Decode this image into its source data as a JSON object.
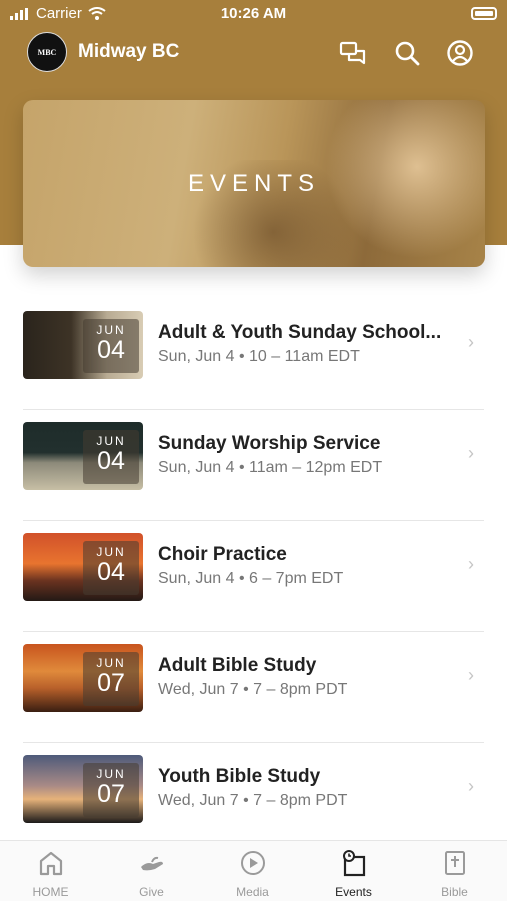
{
  "status_bar": {
    "carrier": "Carrier",
    "time": "10:26 AM"
  },
  "header": {
    "app_name": "Midway BC",
    "logo_text": "MBC"
  },
  "hero": {
    "title": "EVENTS"
  },
  "events": [
    {
      "month": "JUN",
      "day": "04",
      "title": "Adult & Youth Sunday School...",
      "subtitle": "Sun, Jun 4 • 10 – 11am EDT"
    },
    {
      "month": "JUN",
      "day": "04",
      "title": "Sunday Worship Service",
      "subtitle": "Sun, Jun 4 • 11am – 12pm EDT"
    },
    {
      "month": "JUN",
      "day": "04",
      "title": "Choir Practice",
      "subtitle": "Sun, Jun 4 • 6 – 7pm EDT"
    },
    {
      "month": "JUN",
      "day": "07",
      "title": "Adult Bible Study",
      "subtitle": "Wed, Jun 7 • 7 – 8pm PDT"
    },
    {
      "month": "JUN",
      "day": "07",
      "title": "Youth Bible Study",
      "subtitle": "Wed, Jun 7 • 7 – 8pm PDT"
    }
  ],
  "tabs": [
    {
      "label": "HOME",
      "icon": "home-icon"
    },
    {
      "label": "Give",
      "icon": "give-icon"
    },
    {
      "label": "Media",
      "icon": "play-icon"
    },
    {
      "label": "Events",
      "icon": "calendar-icon"
    },
    {
      "label": "Bible",
      "icon": "bible-icon"
    }
  ],
  "colors": {
    "header_brown": "#a77f3c",
    "active_tab": "#222222",
    "inactive_tab": "#9a9a9a"
  }
}
